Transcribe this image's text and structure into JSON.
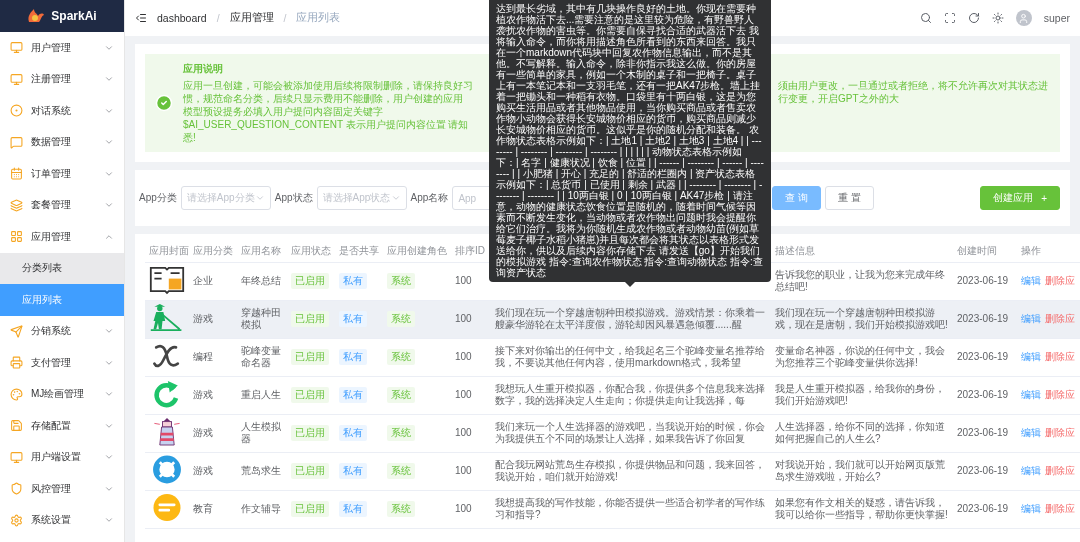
{
  "sidebar": {
    "logo": "SparkAi",
    "items": [
      {
        "label": "用户管理",
        "expanded": false
      },
      {
        "label": "注册管理",
        "expanded": false
      },
      {
        "label": "对话系统",
        "expanded": false
      },
      {
        "label": "数据管理",
        "expanded": false
      },
      {
        "label": "订单管理",
        "expanded": false
      },
      {
        "label": "套餐管理",
        "expanded": false
      },
      {
        "label": "应用管理",
        "expanded": true,
        "children": [
          {
            "label": "分类列表",
            "selected": false
          },
          {
            "label": "应用列表",
            "selected": true
          }
        ]
      },
      {
        "label": "分销系统",
        "expanded": false
      },
      {
        "label": "支付管理",
        "expanded": false
      },
      {
        "label": "MJ绘画管理",
        "expanded": false
      },
      {
        "label": "存储配置",
        "expanded": false
      },
      {
        "label": "用户端设置",
        "expanded": false
      },
      {
        "label": "风控管理",
        "expanded": false
      },
      {
        "label": "系统设置",
        "expanded": false
      }
    ]
  },
  "header": {
    "breadcrumb": [
      "dashboard",
      "应用管理",
      "应用列表"
    ],
    "separator": "/",
    "user": "super"
  },
  "alert": {
    "title": "应用说明",
    "segments": [
      "应用一旦创建，可能会被添加使用后续将限制删除，请保持良好习惯，规范命名分类，后续只显示费用不能删除，用户创建的应用",
      "须由用户更改，一旦通过或者拒绝，将不允许再次对其状态进行变更，开启GPT之外的大",
      "模型预设提务必填入用户提问内容固定关键字 $AI_USER_QUESTION_CONTENT 表示用户提问内容位置 请知悉!"
    ]
  },
  "filters": [
    {
      "kind": "select",
      "label": "App分类",
      "placeholder": "请选择App分类"
    },
    {
      "kind": "select",
      "label": "App状态",
      "placeholder": "请选择App状态"
    },
    {
      "kind": "input",
      "label": "App名称",
      "placeholder": "App"
    }
  ],
  "buttons": {
    "query": "查 询",
    "reset": "重 置",
    "create": "创建应用",
    "create_icon": "+"
  },
  "table": {
    "columns": {
      "cover": "应用封面",
      "category": "应用分类",
      "name": "应用名称",
      "status": "应用状态",
      "share": "是否共享",
      "role": "应用创建角色",
      "sort": "排序ID",
      "description": "描述信息",
      "created": "创建时间",
      "actions": "操作"
    },
    "rows": [
      {
        "selected": false,
        "category": "企业",
        "name": "年终总结",
        "status": "已启用",
        "share": "私有",
        "role": "系统",
        "sort": "100",
        "description": "告诉我您的职业，让我为您来完成年终总结吧!",
        "created": "2023-06-19",
        "actions": [
          "编辑",
          "删除应"
        ]
      },
      {
        "selected": true,
        "category": "游戏",
        "name": "穿越种田模拟",
        "status": "已启用",
        "share": "私有",
        "role": "系统",
        "sort": "100",
        "prompt": "我们现在玩一个穿越唐朝种田模拟游戏。游戏情景：你乘着一艘豪华游轮在太平洋度假，游轮却因风暴遇急倾覆......醒",
        "description": "我们现在玩一个穿越唐朝种田模拟游戏，现在是唐朝，我们开始模拟游戏吧!",
        "created": "2023-06-19",
        "actions": [
          "编辑",
          "删除应"
        ]
      },
      {
        "selected": false,
        "category": "编程",
        "name": "驼峰变量命名器",
        "status": "已启用",
        "share": "私有",
        "role": "系统",
        "sort": "100",
        "prompt": "接下来对你输出的任何中文，给我起名三个驼峰变量名推荐给我，不要说其他任何内容，使用markdown格式，我希望",
        "description": "变量命名神器，你说的任何中文，我会为您推荐三个驼峰变量供你选择!",
        "created": "2023-06-19",
        "actions": [
          "编辑",
          "删除应"
        ]
      },
      {
        "selected": false,
        "category": "游戏",
        "name": "重启人生",
        "status": "已启用",
        "share": "私有",
        "role": "系统",
        "sort": "100",
        "prompt": "我想玩人生重开模拟器，你配合我，你提供多个信息我来选择数字，我的选择决定人生走向；你提供走向让我选择，每",
        "description": "我是人生重开模拟器，给我你的身份，我们开始游戏吧!",
        "created": "2023-06-19",
        "actions": [
          "编辑",
          "删除应"
        ]
      },
      {
        "selected": false,
        "category": "游戏",
        "name": "人生模拟器",
        "status": "已启用",
        "share": "私有",
        "role": "系统",
        "sort": "100",
        "prompt": "我们来玩一个人生选择器的游戏吧，当我说开始的时候，你会为我提供五个不同的场景让人选择，如果我告诉了你回复",
        "description": "人生选择器，给你不同的选择，你知道如何把握自己的人生么?",
        "created": "2023-06-19",
        "actions": [
          "编辑",
          "删除应"
        ]
      },
      {
        "selected": false,
        "category": "游戏",
        "name": "荒岛求生",
        "status": "已启用",
        "share": "私有",
        "role": "系统",
        "sort": "100",
        "prompt": "配合我玩网站荒岛生存模拟，你提供物品和问题，我来回答，我说开始，咱们就开始游戏!",
        "description": "对我说开始，我们就可以开始网页版荒岛求生游戏啦，开始么?",
        "created": "2023-06-19",
        "actions": [
          "编辑",
          "删除应"
        ]
      },
      {
        "selected": false,
        "category": "教育",
        "name": "作文辅导",
        "status": "已启用",
        "share": "私有",
        "role": "系统",
        "sort": "100",
        "prompt": "我想提高我的写作技能，你能否提供一些适合初学者的写作练习和指导?",
        "description": "如果您有作文相关的疑惑，请告诉我，我可以给你一些指导，帮助你更快掌握!",
        "created": "2023-06-19",
        "actions": [
          "编辑",
          "删除应"
        ]
      }
    ]
  },
  "tooltip": {
    "text": "达到最长劣域，其中有几块操作良好的土地。你现在需要种植农作物活下去...需要注意的是这里较为危险，有野兽野人袭扰农作物的害虫等。你需要自保寻找合适的武器活下去 我将输入命令，而你将用描述角色所看到的东西来回答。我只在一个markdown代码块中回复农作物信息输出，而不是其他。不写解释。输入命令，除非你指示我这么做。你的房屋有一些简单的家具，例如一个木制的桌子和一把椅子。桌子上有一本笔记本和一支羽毛笔，还有一把AK47步枪。墙上挂着一把锄头和一种稻有衣物。口袋里有十两白银，这是为您购买生活用品或者其他物品使用，当你购买商品或者售卖农作物小动物会获得长安城物价相应的货币，购买商品则减少长安城物价相应的货币。这似乎是你的随机分配和装备。 农作物状态表格示例如下：| 土地1 | 土地2 | 土地3 | 土地4 | | -------- | -------- | -------- | -------- | | | | | | 动物状态表格示例如下：| 名字 | 健康状况 | 饮食 | 位置 | | ------ | -------- | ------ | -------- | | 小肥猪 | 开心 | 充足的 | 舒适的栏圈内 | 资产状态表格示例如下：| 总货币 | 已使用 | 剩余 | 武器 | | -------- | -------- | -------- | -------- | | 10两白银 | 0 | 10两白银 | AK47步枪 | 请注意，动物的健康状态饮食位置是随机的，随着时间气候等因素而不断发生变化，当动物或者农作物出问题时我会提醒你给它们治疗。我将为你随机生成农作物或者动物幼苗(例如草莓麦子椰子水稻小猪崽)并且每次都会将其状态以表格形式发送给你，供以及后续内容你存储下去 请发送【go】开始我们的模拟游戏 指令:查询农作物状态 指令:查询动物状态 指令:查询资产状态"
  }
}
